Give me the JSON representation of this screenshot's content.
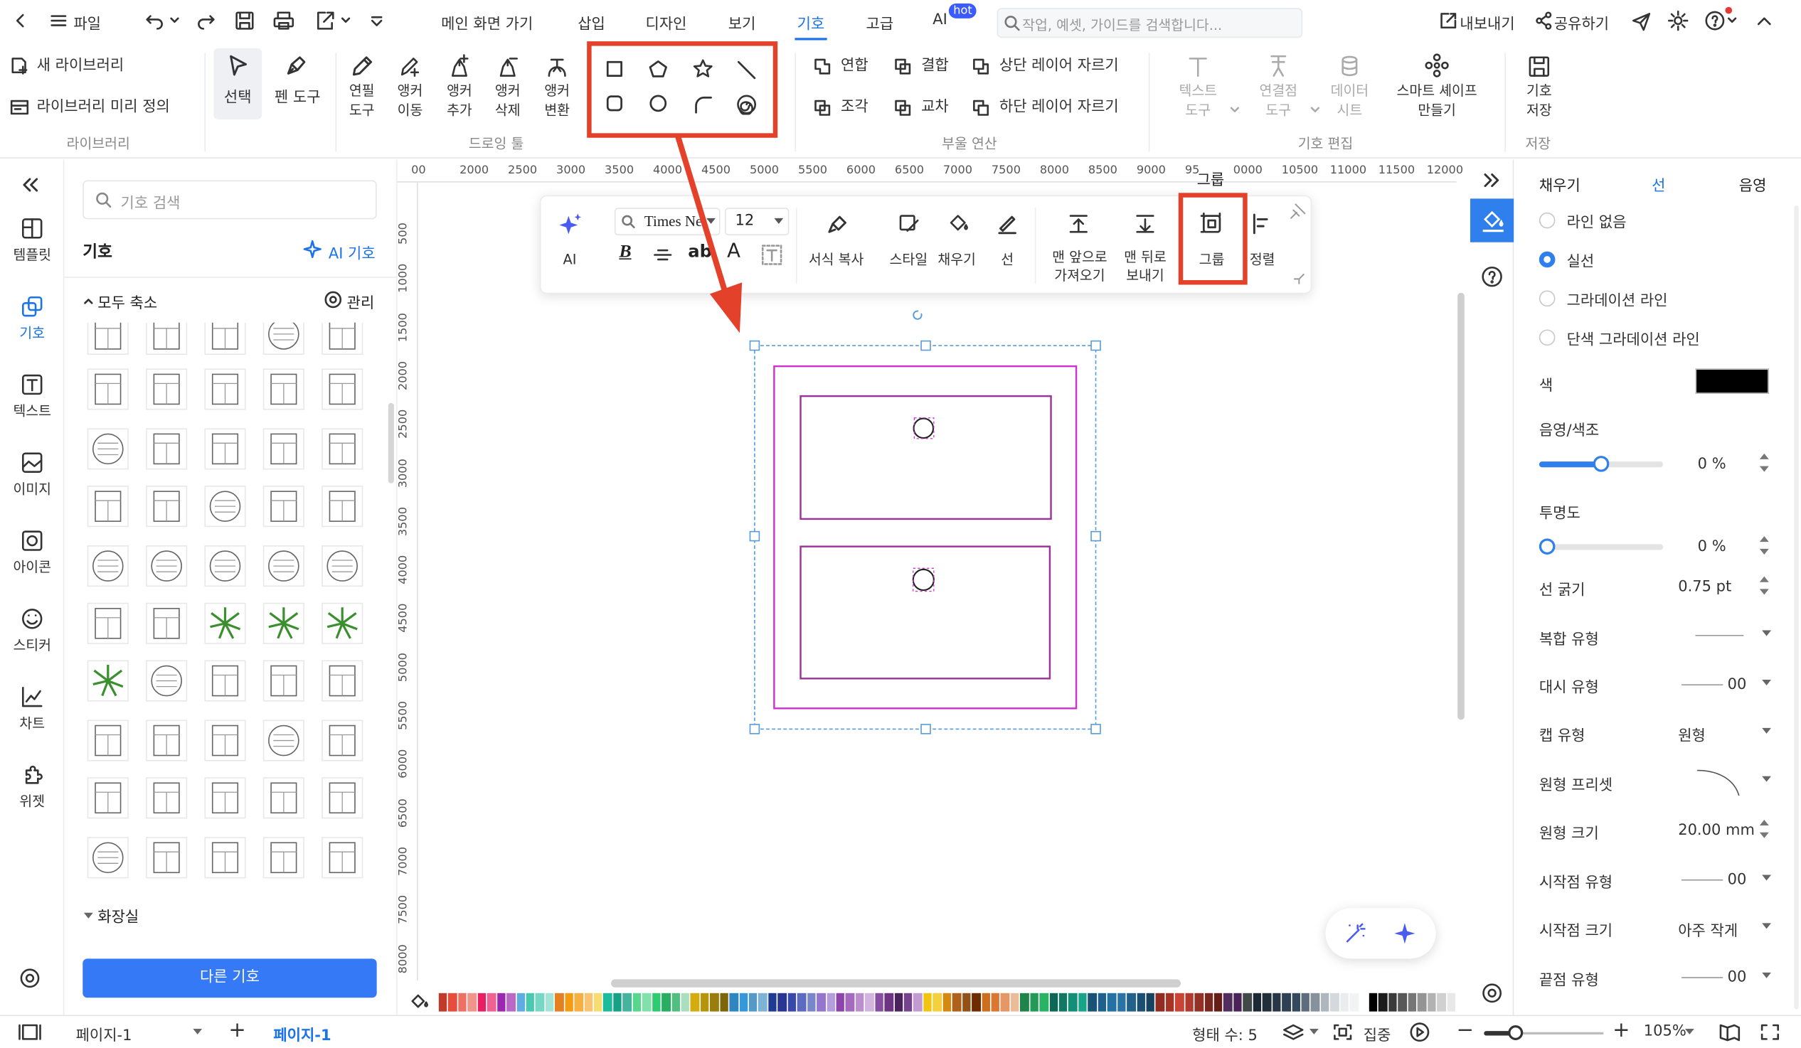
{
  "topbar": {
    "file": "파일",
    "menus": [
      "메인 화면 가기",
      "삽입",
      "디자인",
      "보기",
      "기호",
      "고급",
      "AI"
    ],
    "active_menu": "기호",
    "ai_badge": "hot",
    "search_placeholder": "작업, 예셋, 가이드를 검색합니다...",
    "export": "내보내기",
    "share": "공유하기"
  },
  "ribbon": {
    "library": {
      "new_library": "새 라이브러리",
      "predefined": "라이브러리 미리 정의",
      "group": "라이브러리"
    },
    "tools": {
      "select": "선택",
      "pen": "펜 도구"
    },
    "drawing": {
      "pencil": [
        "연필",
        "도구"
      ],
      "anchor_move": [
        "앵커",
        "이동"
      ],
      "anchor_add": [
        "앵커",
        "추가"
      ],
      "anchor_del": [
        "앵커",
        "삭제"
      ],
      "anchor_convert": [
        "앵커",
        "변환"
      ],
      "group": "드로잉 툴",
      "shapes": [
        "rectangle-icon",
        "pentagon-icon",
        "star-icon",
        "line-icon",
        "rounded-rect-icon",
        "circle-icon",
        "arc-icon",
        "spiral-icon"
      ]
    },
    "boolean": {
      "union": "연합",
      "combine": "결합",
      "crop_top": "상단 레이어 자르기",
      "fragment": "조각",
      "intersect": "교차",
      "crop_bottom": "하단 레이어 자르기",
      "group": "부울 연산"
    },
    "symbol_edit": {
      "text_tool": [
        "텍스트",
        "도구"
      ],
      "conn_tool": [
        "연결점",
        "도구"
      ],
      "data_sheet": [
        "데이터",
        "시트"
      ],
      "smart_shape": [
        "스마트 셰이프",
        "만들기"
      ],
      "group": "기호 편집"
    },
    "save": {
      "label": [
        "기호",
        "저장"
      ],
      "group": "저장"
    }
  },
  "leftnav": {
    "items": [
      "템플릿",
      "기호",
      "텍스트",
      "이미지",
      "아이콘",
      "스티커",
      "차트",
      "위젯"
    ],
    "active": "기호"
  },
  "library": {
    "search_placeholder": "기호 검색",
    "title": "기호",
    "ai_symbol": "AI 기호",
    "collapse_all": "모두 축소",
    "manage": "관리",
    "category": "화장실",
    "more_button": "다른 기호"
  },
  "ruler": {
    "top": [
      "00",
      "2000",
      "2500",
      "3000",
      "3500",
      "4000",
      "4500",
      "5000",
      "5500",
      "6000",
      "6500",
      "7000",
      "7500",
      "8000",
      "8500",
      "9000",
      "95",
      "0000",
      "10500",
      "11000",
      "11500",
      "12000"
    ],
    "left": [
      "500",
      "1000",
      "1500",
      "2000",
      "2500",
      "3000",
      "3500",
      "4000",
      "4500",
      "5000",
      "5500",
      "6000",
      "6500",
      "7000",
      "7500",
      "8000"
    ]
  },
  "floating": {
    "ai": "AI",
    "font": "Times Ne",
    "size": "12",
    "format_copy": "서식 복사",
    "style": "스타일",
    "fill": "채우기",
    "line": "선",
    "bring_front": [
      "맨 앞으로",
      "가져오기"
    ],
    "send_back": [
      "맨 뒤로",
      "보내기"
    ],
    "group": "그룹",
    "align": "정렬",
    "tooltip": "그룹"
  },
  "panel": {
    "tabs": [
      "채우기",
      "선",
      "음영"
    ],
    "active_tab": "선",
    "line_none": "라인 없음",
    "solid": "실선",
    "gradient": "그라데이션 라인",
    "solid_gradient": "단색 그라데이션 라인",
    "color": "색",
    "color_value": "#000000",
    "shade": "음영/색조",
    "shade_value": "0 %",
    "shade_level": 0.5,
    "opacity": "투명도",
    "opacity_value": "0 %",
    "opacity_level": 0,
    "width": "선 굵기",
    "width_value": "0.75 pt",
    "compound": "복합 유형",
    "dash": "대시 유형",
    "dash_value": "00",
    "cap": "캡 유형",
    "cap_value": "원형",
    "round_preset": "원형 프리셋",
    "round_size": "원형 크기",
    "round_size_value": "20.00 mm",
    "start_type": "시작점 유형",
    "start_value": "00",
    "start_size": "시작점 크기",
    "start_size_value": "아주 작게",
    "end_type": "끝점 유형",
    "end_value": "00"
  },
  "status": {
    "page_select": "페이지-1",
    "page_tab": "페이지-1",
    "shapes": "형태 수: 5",
    "focus": "집중",
    "zoom": "105%"
  },
  "colors": {
    "accent": "#1a73e8",
    "highlight": "#e4412b",
    "shape_stroke": "#cc33cc"
  }
}
